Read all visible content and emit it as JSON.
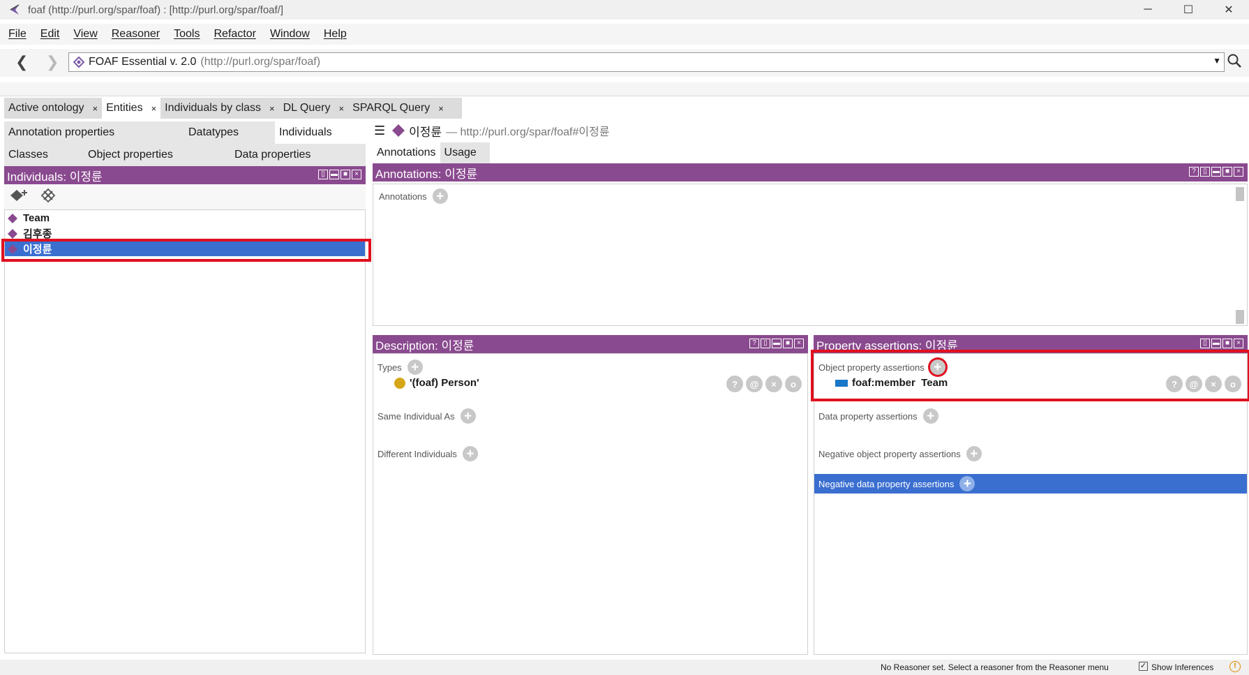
{
  "window": {
    "title": "foaf (http://purl.org/spar/foaf)  : [http://purl.org/spar/foaf/]",
    "minimize": "─",
    "maximize": "☐",
    "close": "✕"
  },
  "menu": [
    "File",
    "Edit",
    "View",
    "Reasoner",
    "Tools",
    "Refactor",
    "Window",
    "Help"
  ],
  "nav": {
    "ontology_name": "FOAF Essential v. 2.0",
    "ontology_iri": "(http://purl.org/spar/foaf)"
  },
  "main_tabs": [
    {
      "label": "Active ontology",
      "close": "×"
    },
    {
      "label": "Entities",
      "close": "×"
    },
    {
      "label": "Individuals by class",
      "close": "×"
    },
    {
      "label": "DL Query",
      "close": "×"
    },
    {
      "label": "SPARQL Query",
      "close": "×"
    }
  ],
  "entity_tabs": {
    "row1": [
      "Annotation properties",
      "Datatypes",
      "Individuals"
    ],
    "row2": [
      "Classes",
      "Object properties",
      "Data properties"
    ]
  },
  "individuals_panel": {
    "header": "Individuals: 이정륜",
    "items": [
      "Team",
      "김후종",
      "이정륜"
    ]
  },
  "entity": {
    "name": "이정륜",
    "iri": "— http://purl.org/spar/foaf#이정륜"
  },
  "right_tabs": [
    "Annotations",
    "Usage"
  ],
  "annotations_panel": {
    "header": "Annotations: 이정륜",
    "section": "Annotations"
  },
  "description_panel": {
    "header": "Description: 이정륜",
    "types_label": "Types",
    "type_value": "'(foaf) Person'",
    "same_label": "Same Individual As",
    "different_label": "Different Individuals"
  },
  "property_panel": {
    "header": "Property assertions: 이정륜",
    "object_label": "Object property assertions",
    "object_assertion": "foaf:member  Team",
    "data_label": "Data property assertions",
    "neg_object_label": "Negative object property assertions",
    "neg_data_label": "Negative data property assertions"
  },
  "status": {
    "text": "No Reasoner set. Select a reasoner from the Reasoner menu",
    "show_inferences": "Show Inferences",
    "checked": "✓"
  },
  "colors": {
    "panel_header": "#8a4a8f",
    "selection": "#3a6fd0",
    "highlight_box": "#e0101f",
    "individual_diamond": "#8a4a8f",
    "class_dot": "#d6a619"
  }
}
